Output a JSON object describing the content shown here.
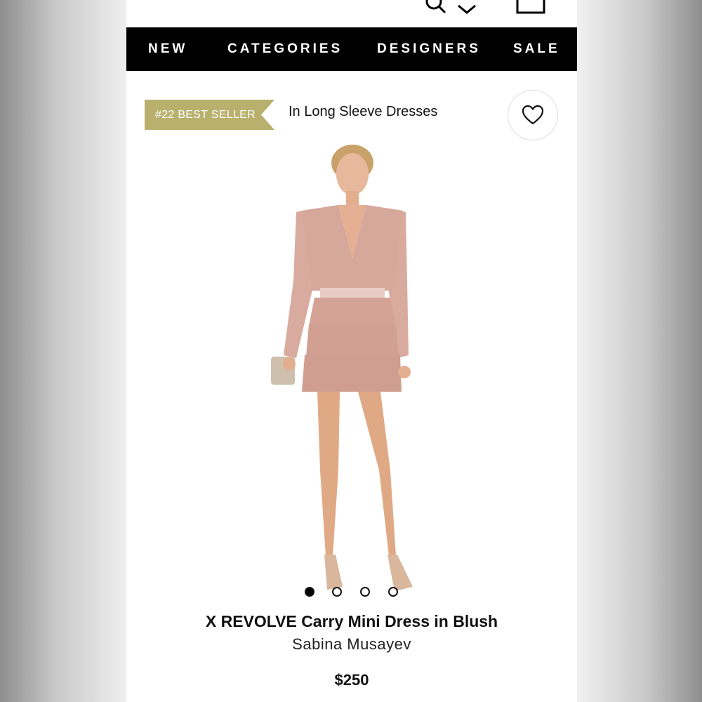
{
  "nav": {
    "items": [
      {
        "label": "NEW"
      },
      {
        "label": "CATEGORIES"
      },
      {
        "label": "DESIGNERS"
      },
      {
        "label": "SALE"
      }
    ]
  },
  "badge": {
    "label": "#22 BEST SELLER",
    "color": "#b9b06d"
  },
  "category_label": "In Long Sleeve Dresses",
  "icons": {
    "wishlist": "heart-icon",
    "search": "search-icon",
    "account": "account-icon",
    "bag": "bag-icon"
  },
  "carousel": {
    "total": 4,
    "active_index": 1
  },
  "product": {
    "title": "X REVOLVE Carry Mini Dress in Blush",
    "designer": "Sabina Musayev",
    "price": "$250"
  }
}
